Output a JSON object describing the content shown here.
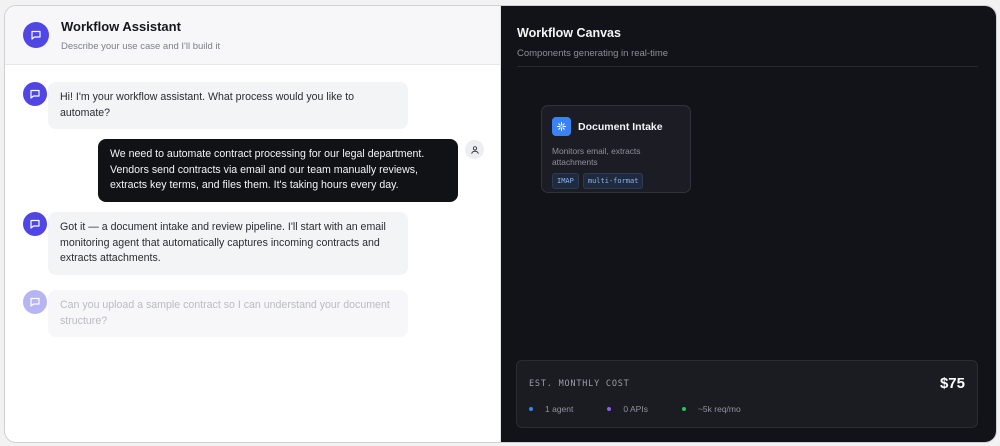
{
  "chat": {
    "title": "Workflow Assistant",
    "subtitle": "Describe your use case and I'll build it",
    "messages": [
      {
        "role": "assistant",
        "text": "Hi! I'm your workflow assistant. What process would you like to automate?"
      },
      {
        "role": "user",
        "text": "We need to automate contract processing for our legal department. Vendors send contracts via email and our team manually reviews, extracts key terms, and files them. It's taking hours every day."
      },
      {
        "role": "assistant",
        "text": "Got it — a document intake and review pipeline. I'll start with an email monitoring agent that automatically captures incoming contracts and extracts attachments."
      },
      {
        "role": "assistant",
        "state": "typing",
        "text": "Can you upload a sample contract so I can understand your document structure?"
      }
    ]
  },
  "canvas": {
    "title": "Workflow Canvas",
    "subtitle": "Components generating in real-time",
    "card": {
      "title": "Document Intake",
      "description": "Monitors email, extracts attachments",
      "tags": [
        "IMAP",
        "multi-format"
      ],
      "icon": "sparkle-icon",
      "icon_color": "#3b82f6"
    },
    "cost": {
      "label": "EST. MONTHLY COST",
      "value": "$75",
      "stats": [
        {
          "text": "1 agent",
          "color": "#3b82f6"
        },
        {
          "text": "0 APIs",
          "color": "#8b5cf6"
        },
        {
          "text": "~5k req/mo",
          "color": "#22c55e"
        }
      ]
    }
  },
  "colors": {
    "accent": "#4f46e5",
    "canvas_bg": "#121318",
    "user_bubble": "#111216"
  }
}
